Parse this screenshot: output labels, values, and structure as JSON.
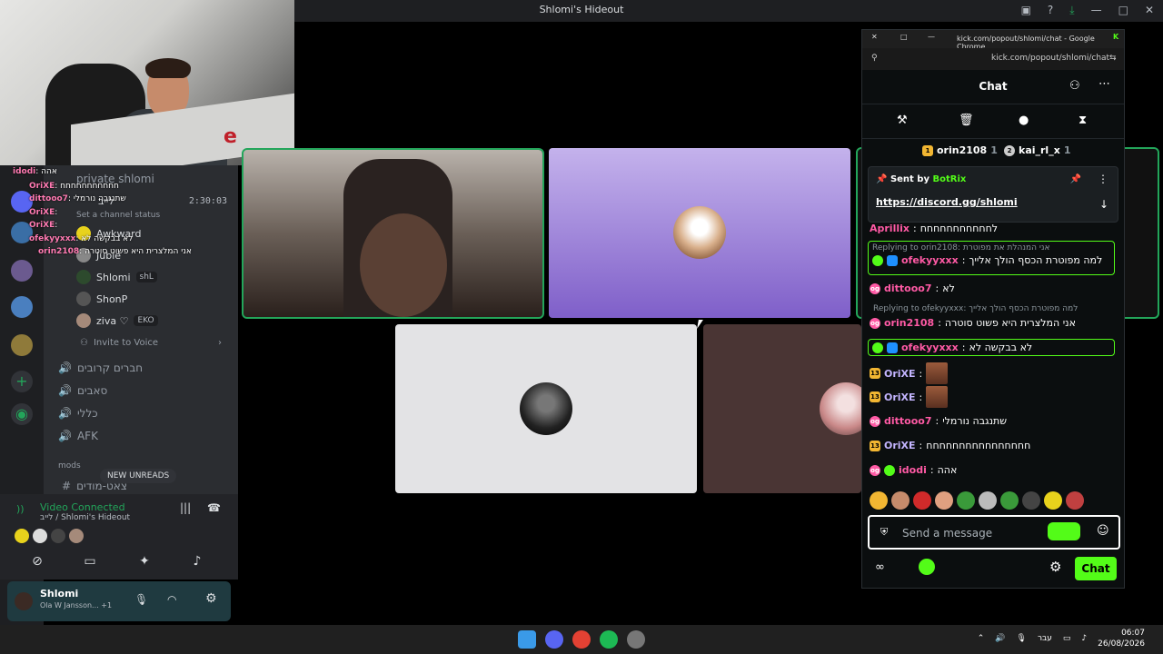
{
  "window": {
    "title": "Shlomi's Hideout"
  },
  "stream_overlay": {
    "lines": [
      {
        "user": "idodi",
        "text": ": אהה"
      },
      {
        "user": "OriXE",
        "text": ": חחחחחחחחחחח"
      },
      {
        "user": "dittooo7",
        "text": ": שתנגבה נורמלי"
      },
      {
        "user": "OriXE",
        "text": ":"
      },
      {
        "user": "OriXE",
        "text": ":"
      },
      {
        "user": "ofekyyxxx",
        "text": ": לא בבקשה לא"
      },
      {
        "user": "orin2108",
        "text": ": אני המלצרית היא פשוט סוטרה"
      }
    ]
  },
  "discord": {
    "channel_header": "private shlomi",
    "voice_channel": "לייב",
    "timer": "2:30:03",
    "status_hint": "Set a channel status",
    "members": [
      {
        "name": "Awkward"
      },
      {
        "name": "Jubie"
      },
      {
        "name": "Shlomi",
        "tag": "shL"
      },
      {
        "name": "ShonP"
      },
      {
        "name": "ziva ♡",
        "tag": "EKO"
      }
    ],
    "invite": "Invite to Voice",
    "channels": [
      "חברים קרובים",
      "סאבים",
      "כללי",
      "AFK"
    ],
    "category": "mods",
    "new_unreads": "NEW UNREADS",
    "text_channel": "צאט-מודים",
    "voice_connected": "Video Connected",
    "voice_sub": "לייב / Shlomi's Hideout",
    "user": {
      "name": "Shlomi",
      "activity": "Ola W Jansson...",
      "extra": "+1"
    }
  },
  "kick": {
    "chrome_title": "kick.com/popout/shlomi/chat - Google Chrome",
    "url": "kick.com/popout/shlomi/chat",
    "header": "Chat",
    "leaders": [
      {
        "rank": "1",
        "name": "orin2108",
        "count": "1"
      },
      {
        "rank": "2",
        "name": "kai_rl_x",
        "count": "1"
      }
    ],
    "pinned": {
      "sent_by": "Sent by",
      "bot": "BotRix",
      "link": "https://discord.gg/shlomi"
    },
    "messages": [
      {
        "user": "Aprillix",
        "color": "#ff5aa5",
        "text": "לחחחחחחחחחחח"
      },
      {
        "reply": "Replying to orin2108: אני המנהלת את מפוטרת"
      },
      {
        "user": "ofekyyxxx",
        "color": "#ff5aa5",
        "text": "למה מפוטרת הכסף הולך אלייך",
        "boxed": true
      },
      {
        "user": "dittooo7",
        "color": "#ff5aa5",
        "text": "לא"
      },
      {
        "reply": "Replying to ofekyyxxx: למה מפוטרת הכסף הולך אלייך"
      },
      {
        "user": "orin2108",
        "color": "#ff5aa5",
        "text": "אני המלצרית היא פשוט סוטרה"
      },
      {
        "user": "ofekyyxxx",
        "color": "#ff5aa5",
        "text": "לא בבקשה לא",
        "boxed": true
      },
      {
        "user": "OriXE",
        "color": "#c4b5ff",
        "text": ""
      },
      {
        "user": "OriXE",
        "color": "#c4b5ff",
        "text": ""
      },
      {
        "user": "dittooo7",
        "color": "#ff5aa5",
        "text": "שתנגבה נורמלי"
      },
      {
        "user": "OriXE",
        "color": "#c4b5ff",
        "text": "חחחחחחחחחחחחחחחח"
      },
      {
        "user": "idodi",
        "color": "#ff5aa5",
        "text": "אהה"
      }
    ],
    "input_placeholder": "Send a message",
    "chat_button": "Chat"
  },
  "taskbar": {
    "lang": "עבר",
    "time": "06:07",
    "date": "26/08/2026"
  },
  "colors": {
    "kick_green": "#53fc18",
    "discord_green": "#23a55a"
  }
}
